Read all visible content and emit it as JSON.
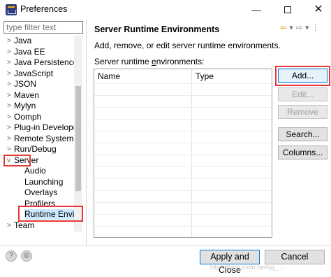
{
  "window": {
    "title": "Preferences",
    "minimize": "—",
    "close": "✕"
  },
  "sidebar": {
    "filter_placeholder": "type filter text",
    "items": [
      {
        "label": "Java",
        "twisty": ">"
      },
      {
        "label": "Java EE",
        "twisty": ">"
      },
      {
        "label": "Java Persistence",
        "twisty": ">"
      },
      {
        "label": "JavaScript",
        "twisty": ">"
      },
      {
        "label": "JSON",
        "twisty": ">"
      },
      {
        "label": "Maven",
        "twisty": ">"
      },
      {
        "label": "Mylyn",
        "twisty": ">"
      },
      {
        "label": "Oomph",
        "twisty": ">"
      },
      {
        "label": "Plug-in Developm",
        "twisty": ">"
      },
      {
        "label": "Remote Systems",
        "twisty": ">"
      },
      {
        "label": "Run/Debug",
        "twisty": ">"
      },
      {
        "label": "Server",
        "twisty": "v"
      }
    ],
    "server_children": [
      "Audio",
      "Launching",
      "Overlays",
      "Profilers",
      "Runtime Envir"
    ],
    "after_items": [
      {
        "label": "Team",
        "twisty": ">"
      }
    ]
  },
  "page": {
    "title": "Server Runtime Environments",
    "description": "Add, remove, or edit server runtime environments.",
    "list_label_pre": "Server runtime ",
    "list_label_underlined": "e",
    "list_label_post": "nvironments:",
    "nav_icons": [
      "back-arrow",
      "menu-dropdown",
      "forward-arrow",
      "menu-dropdown",
      "view-menu"
    ]
  },
  "table": {
    "columns": [
      "Name",
      "Type"
    ],
    "rows": []
  },
  "buttons": {
    "add": "Add...",
    "edit": "Edit...",
    "remove": "Remove",
    "search": "Search...",
    "columns": "Columns..."
  },
  "footer": {
    "help_icon": "?",
    "apply_close": "Apply and Close",
    "cancel": "Cancel"
  },
  "watermark": "https://blog.csdn.net/qq_..."
}
